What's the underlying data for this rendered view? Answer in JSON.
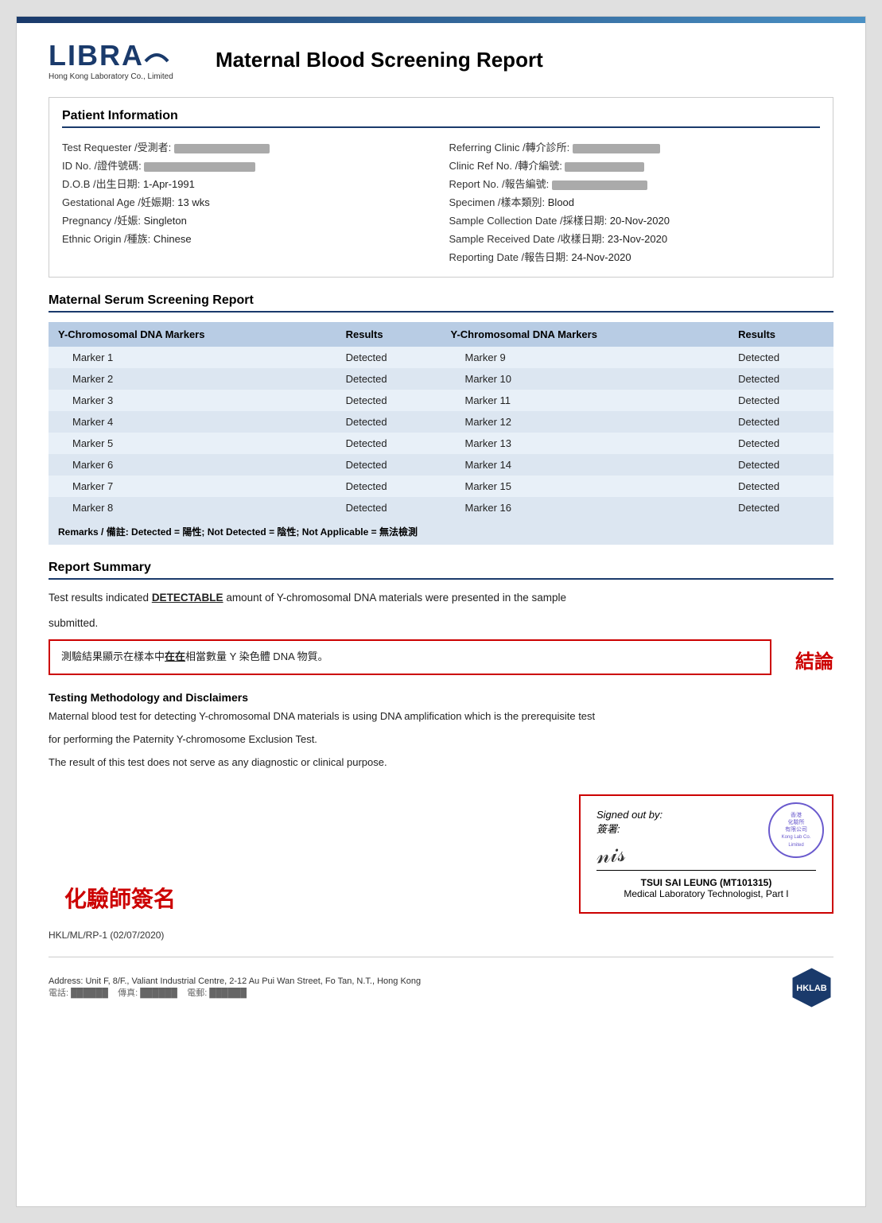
{
  "header": {
    "logo_name": "LIBRA",
    "logo_sub": "Hong Kong Laboratory Co., Limited",
    "report_title": "Maternal Blood Screening Report"
  },
  "patient_info": {
    "section_title": "Patient Information",
    "left_fields": [
      {
        "label": "Test Requester /受測者:",
        "value": "REDACTED",
        "blurred": true
      },
      {
        "label": "ID No. /證件號碼:",
        "value": "REDACTED",
        "blurred": true
      },
      {
        "label": "D.O.B /出生日期:",
        "value": "1-Apr-1991"
      },
      {
        "label": "Gestational Age /妊娠期:",
        "value": "13 wks"
      },
      {
        "label": "Pregnancy /妊娠:",
        "value": "Singleton"
      },
      {
        "label": "Ethnic Origin /種族:",
        "value": "Chinese"
      }
    ],
    "right_fields": [
      {
        "label": "Referring Clinic /轉介診所:",
        "value": "REDACTED",
        "blurred": true
      },
      {
        "label": "Clinic Ref No. /轉介編號:",
        "value": "REDACTED",
        "blurred": true
      },
      {
        "label": "Report No. /報告編號:",
        "value": "REDACTED",
        "blurred": true
      },
      {
        "label": "Specimen /樣本類別:",
        "value": "Blood"
      },
      {
        "label": "Sample Collection Date /採樣日期:",
        "value": "20-Nov-2020"
      },
      {
        "label": "Sample Received Date /收樣日期:",
        "value": "23-Nov-2020"
      },
      {
        "label": "Reporting Date /報告日期:",
        "value": "24-Nov-2020"
      }
    ]
  },
  "serum_section": {
    "section_title": "Maternal Serum Screening Report",
    "col1_header": "Y-Chromosomal DNA Markers",
    "col2_header": "Results",
    "col3_header": "Y-Chromosomal DNA Markers",
    "col4_header": "Results",
    "rows": [
      {
        "marker_left": "Marker 1",
        "result_left": "Detected",
        "marker_right": "Marker 9",
        "result_right": "Detected"
      },
      {
        "marker_left": "Marker 2",
        "result_left": "Detected",
        "marker_right": "Marker 10",
        "result_right": "Detected"
      },
      {
        "marker_left": "Marker 3",
        "result_left": "Detected",
        "marker_right": "Marker 11",
        "result_right": "Detected"
      },
      {
        "marker_left": "Marker 4",
        "result_left": "Detected",
        "marker_right": "Marker 12",
        "result_right": "Detected"
      },
      {
        "marker_left": "Marker 5",
        "result_left": "Detected",
        "marker_right": "Marker 13",
        "result_right": "Detected"
      },
      {
        "marker_left": "Marker 6",
        "result_left": "Detected",
        "marker_right": "Marker 14",
        "result_right": "Detected"
      },
      {
        "marker_left": "Marker 7",
        "result_left": "Detected",
        "marker_right": "Marker 15",
        "result_right": "Detected"
      },
      {
        "marker_left": "Marker 8",
        "result_left": "Detected",
        "marker_right": "Marker 16",
        "result_right": "Detected"
      }
    ],
    "remarks": "Remarks / 備註: Detected = 陽性; Not Detected = 陰性; Not Applicable = 無法檢測"
  },
  "report_summary": {
    "section_title": "Report Summary",
    "summary_line1": "Test results indicated ",
    "detectable": "DETECTABLE",
    "summary_line2": " amount of Y-chromosomal DNA materials were presented in the sample",
    "summary_line3": "submitted.",
    "conclusion_chinese": "測驗結果顯示在樣本中",
    "conclusion_chinese_bold": "在在",
    "conclusion_chinese_end": "相當數量 Y 染色體 DNA 物質。",
    "conclusion_label": "結論"
  },
  "methodology": {
    "title": "Testing Methodology and Disclaimers",
    "text1": "Maternal blood test for detecting Y-chromosomal DNA materials is using DNA amplification which is the prerequisite test",
    "text2": "for performing the Paternity Y-chromosome Exclusion Test.",
    "text3": "The result of this test does not serve as any diagnostic or clinical purpose."
  },
  "signature": {
    "chemist_label": "化驗師簽名",
    "signed_out_by": "Signed out by:",
    "signed_out_chinese": "簽署:",
    "signatory_name": "TSUI SAI LEUNG (MT101315)",
    "signatory_title": "Medical Laboratory Technologist, Part I",
    "stamp_lines": [
      "香港",
      "化驗所",
      "有限公司",
      "Kong Lab Co.",
      "Limited"
    ]
  },
  "doc_ref": {
    "text": "HKL/ML/RP-1 (02/07/2020)"
  },
  "footer": {
    "address": "Address: Unit F, 8/F., Valiant Industrial Centre, 2-12 Au Pui Wan Street, Fo Tan, N.T., Hong Kong",
    "phone_line": "電話: [redacted]    傳真: [redacted]    電郵: [redacted]",
    "hklab_label": "HKLAB"
  }
}
